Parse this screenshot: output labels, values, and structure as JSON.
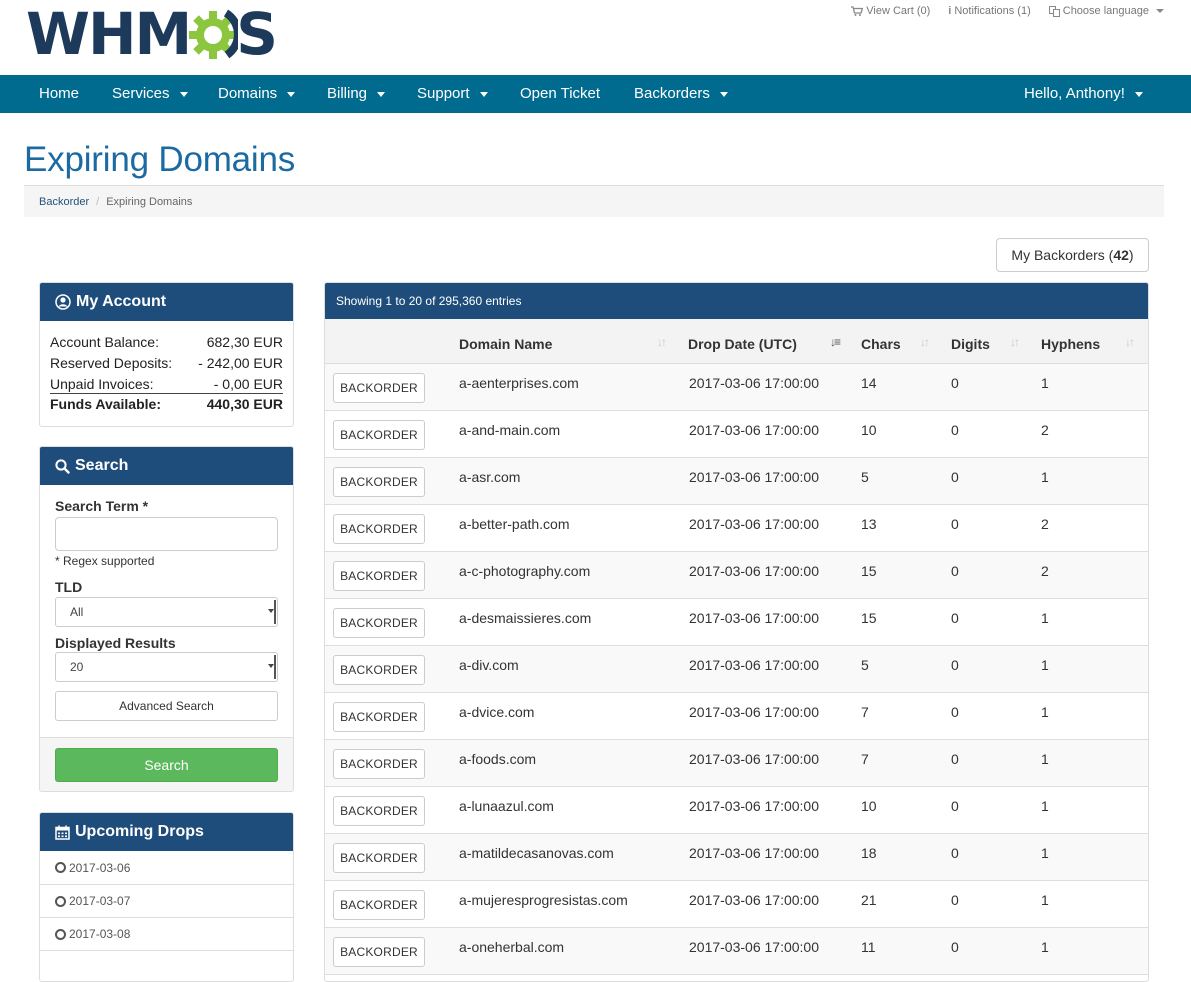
{
  "header": {
    "logo": "WHMCS",
    "top_links": {
      "view_cart": "View Cart (0)",
      "notifications": "Notifications (1)",
      "choose_language": "Choose language"
    }
  },
  "nav": {
    "items": [
      {
        "label": "Home",
        "dropdown": false
      },
      {
        "label": "Services",
        "dropdown": true
      },
      {
        "label": "Domains",
        "dropdown": true
      },
      {
        "label": "Billing",
        "dropdown": true
      },
      {
        "label": "Support",
        "dropdown": true
      },
      {
        "label": "Open Ticket",
        "dropdown": false
      },
      {
        "label": "Backorders",
        "dropdown": true
      }
    ],
    "user": "Hello, Anthony!"
  },
  "page": {
    "title": "Expiring Domains",
    "breadcrumb": [
      "Backorder",
      "Expiring Domains"
    ],
    "my_backorders_label": "My Backorders",
    "my_backorders_count": "42"
  },
  "account": {
    "title": "My Account",
    "rows": [
      {
        "label": "Account Balance:",
        "value": "682,30 EUR"
      },
      {
        "label": "Reserved Deposits:",
        "value": "- 242,00 EUR"
      },
      {
        "label": "Unpaid Invoices:",
        "value": "- 0,00 EUR"
      }
    ],
    "total_label": "Funds Available:",
    "total_value": "440,30 EUR"
  },
  "search": {
    "title": "Search",
    "term_label": "Search Term *",
    "term_value": "",
    "regex_note": "* Regex supported",
    "tld_label": "TLD",
    "tld_value": "All",
    "results_label": "Displayed Results",
    "results_value": "20",
    "advanced_label": "Advanced Search",
    "submit_label": "Search"
  },
  "upcoming": {
    "title": "Upcoming Drops",
    "dates": [
      "2017-03-06",
      "2017-03-07",
      "2017-03-08"
    ]
  },
  "table": {
    "info": "Showing 1 to 20 of 295,360 entries",
    "columns": [
      "Domain Name",
      "Drop Date (UTC)",
      "Chars",
      "Digits",
      "Hyphens"
    ],
    "button_label": "BACKORDER",
    "rows": [
      {
        "domain": "a-aenterprises.com",
        "date": "2017-03-06 17:00:00",
        "chars": "14",
        "digits": "0",
        "hyphens": "1"
      },
      {
        "domain": "a-and-main.com",
        "date": "2017-03-06 17:00:00",
        "chars": "10",
        "digits": "0",
        "hyphens": "2"
      },
      {
        "domain": "a-asr.com",
        "date": "2017-03-06 17:00:00",
        "chars": "5",
        "digits": "0",
        "hyphens": "1"
      },
      {
        "domain": "a-better-path.com",
        "date": "2017-03-06 17:00:00",
        "chars": "13",
        "digits": "0",
        "hyphens": "2"
      },
      {
        "domain": "a-c-photography.com",
        "date": "2017-03-06 17:00:00",
        "chars": "15",
        "digits": "0",
        "hyphens": "2"
      },
      {
        "domain": "a-desmaissieres.com",
        "date": "2017-03-06 17:00:00",
        "chars": "15",
        "digits": "0",
        "hyphens": "1"
      },
      {
        "domain": "a-div.com",
        "date": "2017-03-06 17:00:00",
        "chars": "5",
        "digits": "0",
        "hyphens": "1"
      },
      {
        "domain": "a-dvice.com",
        "date": "2017-03-06 17:00:00",
        "chars": "7",
        "digits": "0",
        "hyphens": "1"
      },
      {
        "domain": "a-foods.com",
        "date": "2017-03-06 17:00:00",
        "chars": "7",
        "digits": "0",
        "hyphens": "1"
      },
      {
        "domain": "a-lunaazul.com",
        "date": "2017-03-06 17:00:00",
        "chars": "10",
        "digits": "0",
        "hyphens": "1"
      },
      {
        "domain": "a-matildecasanovas.com",
        "date": "2017-03-06 17:00:00",
        "chars": "18",
        "digits": "0",
        "hyphens": "1"
      },
      {
        "domain": "a-mujeresprogresistas.com",
        "date": "2017-03-06 17:00:00",
        "chars": "21",
        "digits": "0",
        "hyphens": "1"
      },
      {
        "domain": "a-oneherbal.com",
        "date": "2017-03-06 17:00:00",
        "chars": "11",
        "digits": "0",
        "hyphens": "1"
      }
    ]
  },
  "colors": {
    "nav_bg": "#006b8f",
    "panel_head": "#1f4d7b",
    "title_blue": "#1b6aa2",
    "search_green": "#5cb85c",
    "logo_navy": "#1d3a5a",
    "logo_green": "#8cc63f"
  }
}
